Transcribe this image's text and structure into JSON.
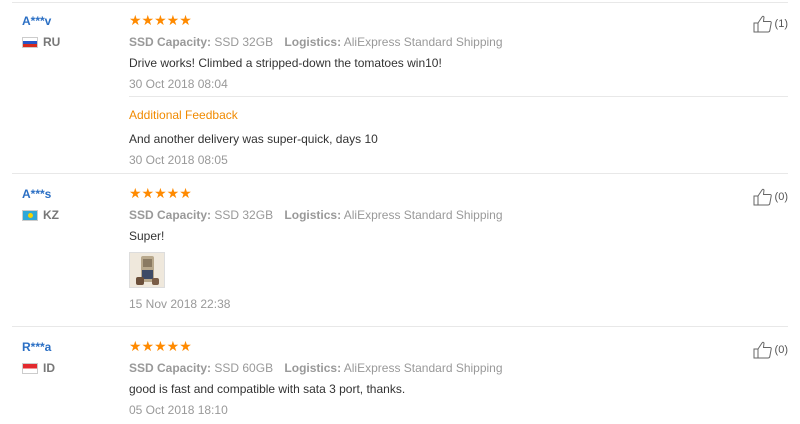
{
  "reviews": [
    {
      "user": "A***v",
      "country": "RU",
      "stars": "★★★★★",
      "capacity_label": "SSD Capacity:",
      "capacity_value": "SSD 32GB",
      "logistics_label": "Logistics:",
      "logistics_value": "AliExpress Standard Shipping",
      "text": "Drive works! Climbed a stripped-down the tomatoes win10!",
      "date": "30 Oct 2018 08:04",
      "additional_title": "Additional Feedback",
      "additional_text": "And another delivery was super-quick, days 10",
      "additional_date": "30 Oct 2018 08:05",
      "helpful": "(1)"
    },
    {
      "user": "A***s",
      "country": "KZ",
      "stars": "★★★★★",
      "capacity_label": "SSD Capacity:",
      "capacity_value": "SSD 32GB",
      "logistics_label": "Logistics:",
      "logistics_value": "AliExpress Standard Shipping",
      "text": "Super!",
      "date": "15 Nov 2018 22:38",
      "helpful": "(0)"
    },
    {
      "user": "R***a",
      "country": "ID",
      "stars": "★★★★★",
      "capacity_label": "SSD Capacity:",
      "capacity_value": "SSD 60GB",
      "logistics_label": "Logistics:",
      "logistics_value": "AliExpress Standard Shipping",
      "text": "good is fast and compatible with sata 3 port, thanks.",
      "date": "05 Oct 2018 18:10",
      "helpful": "(0)"
    }
  ],
  "colors": {
    "star": "#ff8a00",
    "username": "#2b6fc4",
    "additional": "#f08a00"
  },
  "icons": {
    "helpful": "thumbs-up-icon"
  }
}
